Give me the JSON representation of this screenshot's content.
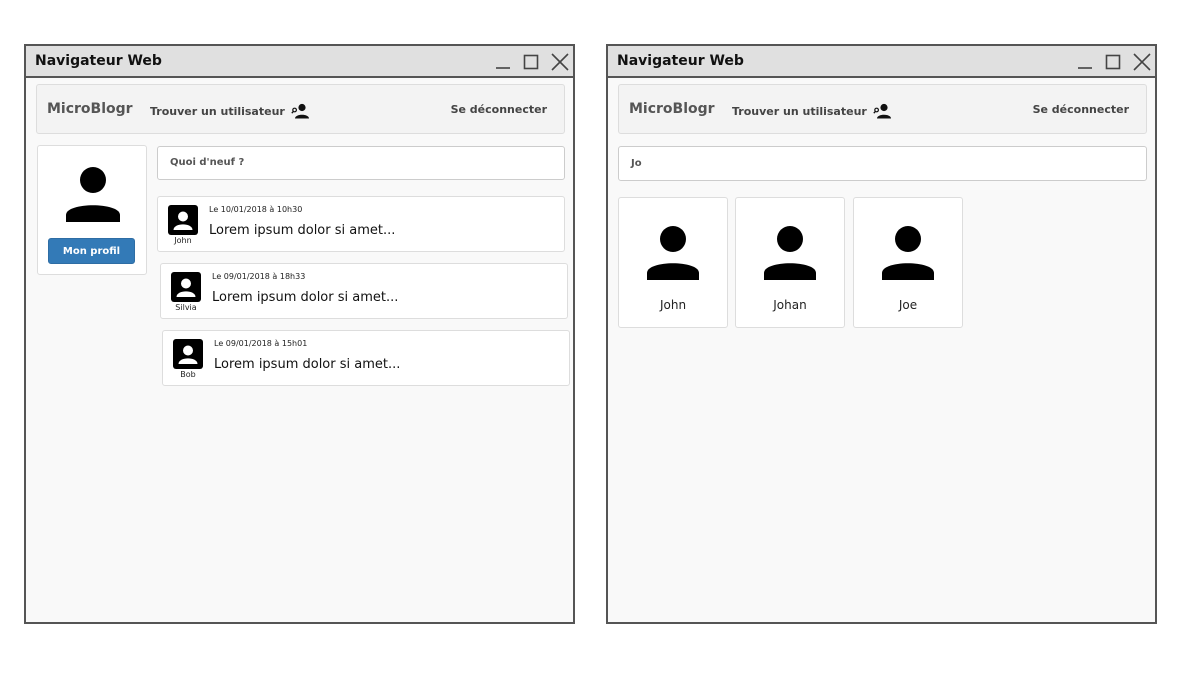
{
  "windows": [
    {
      "title": "Navigateur Web",
      "navbar": {
        "brand": "MicroBlogr",
        "find_user": "Trouver un utilisateur",
        "logout": "Se déconnecter"
      },
      "profile_button": "Mon profil",
      "compose_placeholder": "Quoi d'neuf ?",
      "posts": [
        {
          "author": "John",
          "date": "Le 10/01/2018 à 10h30",
          "text": "Lorem ipsum dolor si amet..."
        },
        {
          "author": "Silvia",
          "date": "Le 09/01/2018 à 18h33",
          "text": "Lorem ipsum dolor si amet..."
        },
        {
          "author": "Bob",
          "date": "Le 09/01/2018 à 15h01",
          "text": "Lorem ipsum dolor si amet..."
        }
      ]
    },
    {
      "title": "Navigateur Web",
      "navbar": {
        "brand": "MicroBlogr",
        "find_user": "Trouver un utilisateur",
        "logout": "Se déconnecter"
      },
      "search_value": "Jo",
      "results": [
        {
          "name": "John"
        },
        {
          "name": "Johan"
        },
        {
          "name": "Joe"
        }
      ]
    }
  ],
  "icons": {
    "minimize": "minimize-icon",
    "maximize": "maximize-icon",
    "close": "close-icon",
    "find_user": "user-search-icon",
    "avatar": "user-avatar-icon",
    "post_avatar": "account-box-icon"
  },
  "colors": {
    "primary_button": "#337ab7"
  }
}
